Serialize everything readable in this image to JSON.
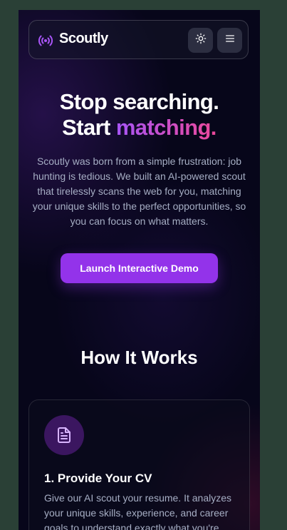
{
  "header": {
    "brand": "Scoutly",
    "logo_icon": "radio-broadcast-icon",
    "theme_toggle_icon": "sun-icon",
    "menu_icon": "hamburger-menu-icon"
  },
  "hero": {
    "title_line1": "Stop searching.",
    "title_line2_plain": "Start ",
    "title_line2_accent": "matching.",
    "description": "Scoutly was born from a simple frustration: job hunting is tedious. We built an AI-powered scout that tirelessly scans the web for you, matching your unique skills to the perfect opportunities, so you can focus on what matters.",
    "cta_label": "Launch Interactive Demo"
  },
  "how_it_works": {
    "title": "How It Works",
    "steps": [
      {
        "icon": "document-icon",
        "title": "1. Provide Your CV",
        "description": "Give our AI scout your resume. It analyzes your unique skills, experience, and career goals to understand exactly what you're"
      }
    ]
  },
  "colors": {
    "accent_purple": "#9333ea",
    "accent_gradient_start": "#a855f7",
    "accent_gradient_end": "#ec4899",
    "background": "#07061a",
    "muted_text": "#a6aec4"
  }
}
